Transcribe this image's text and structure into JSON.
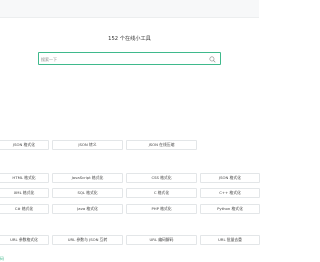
{
  "hero": {
    "title": "152 个在线小工具"
  },
  "search": {
    "placeholder": "搜索一下"
  },
  "tools": {
    "row1": [
      "JSON 格式化",
      "JSON 转义",
      "JSON 在线压缩"
    ],
    "row2": [
      "HTML 格式化",
      "JavaScript 格式化",
      "CSS 格式化",
      "JSON 格式化"
    ],
    "row3": [
      "XML 格式化",
      "SQL 格式化",
      "C 格式化",
      "C++ 格式化"
    ],
    "row4": [
      "C# 格式化",
      "Java 格式化",
      "PHP 格式化",
      "Python 格式化"
    ],
    "row5": [
      "URL 参数格式化",
      "URL 参数与 JSON 互转",
      "URL 编码解码",
      "URL 批量去重"
    ]
  },
  "footer": {
    "link": "码"
  },
  "colors": {
    "accent": "#3fb98c",
    "border": "#e3e6e8"
  }
}
